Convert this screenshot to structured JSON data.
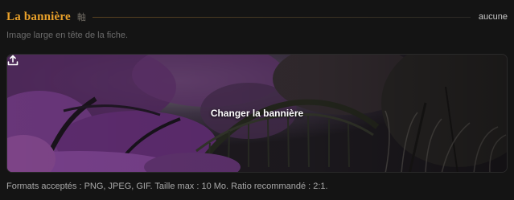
{
  "section": {
    "title": "La bannière",
    "title_glyph": "軸",
    "status": "aucune",
    "subtitle": "Image large en tête de la fiche."
  },
  "banner": {
    "change_label": "Changer la bannière",
    "icon": "upload-icon"
  },
  "footnote": "Formats acceptés : PNG, JPEG, GIF. Taille max : 10 Mo. Ratio recommandé : 2:1.",
  "colors": {
    "accent": "#e9a12a",
    "background": "#141414",
    "foliage": "#7a3f8e"
  }
}
